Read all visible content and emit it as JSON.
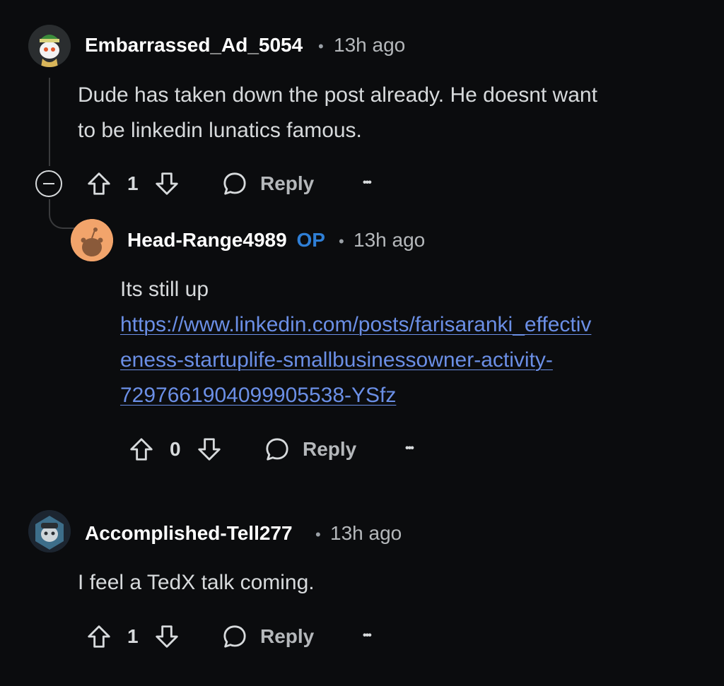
{
  "comments": [
    {
      "username": "Embarrassed_Ad_5054",
      "time": "13h ago",
      "text_lines": [
        "Dude has taken down the post already. He doesnt want",
        "to be linkedin lunatics famous."
      ],
      "score": "1",
      "reply_label": "Reply",
      "more_label": "•••"
    },
    {
      "username": "Head-Range4989",
      "badge": "OP",
      "time": "13h ago",
      "text": "Its still up",
      "link_lines": [
        "https://www.linkedin.com/posts/farisaranki_effectiv",
        "eness-startuplife-smallbusinessowner-activity-",
        "7297661904099905538-YSfz"
      ],
      "score": "0",
      "reply_label": "Reply",
      "more_label": "•••"
    },
    {
      "username": "Accomplished-Tell277",
      "time": "13h ago",
      "text": "I feel a TedX talk coming.",
      "score": "1",
      "reply_label": "Reply",
      "more_label": "•••"
    }
  ],
  "separator": "•",
  "colors": {
    "background": "#0b0c0e",
    "op_badge": "#2f7fd6",
    "link": "#6b8fe6"
  }
}
